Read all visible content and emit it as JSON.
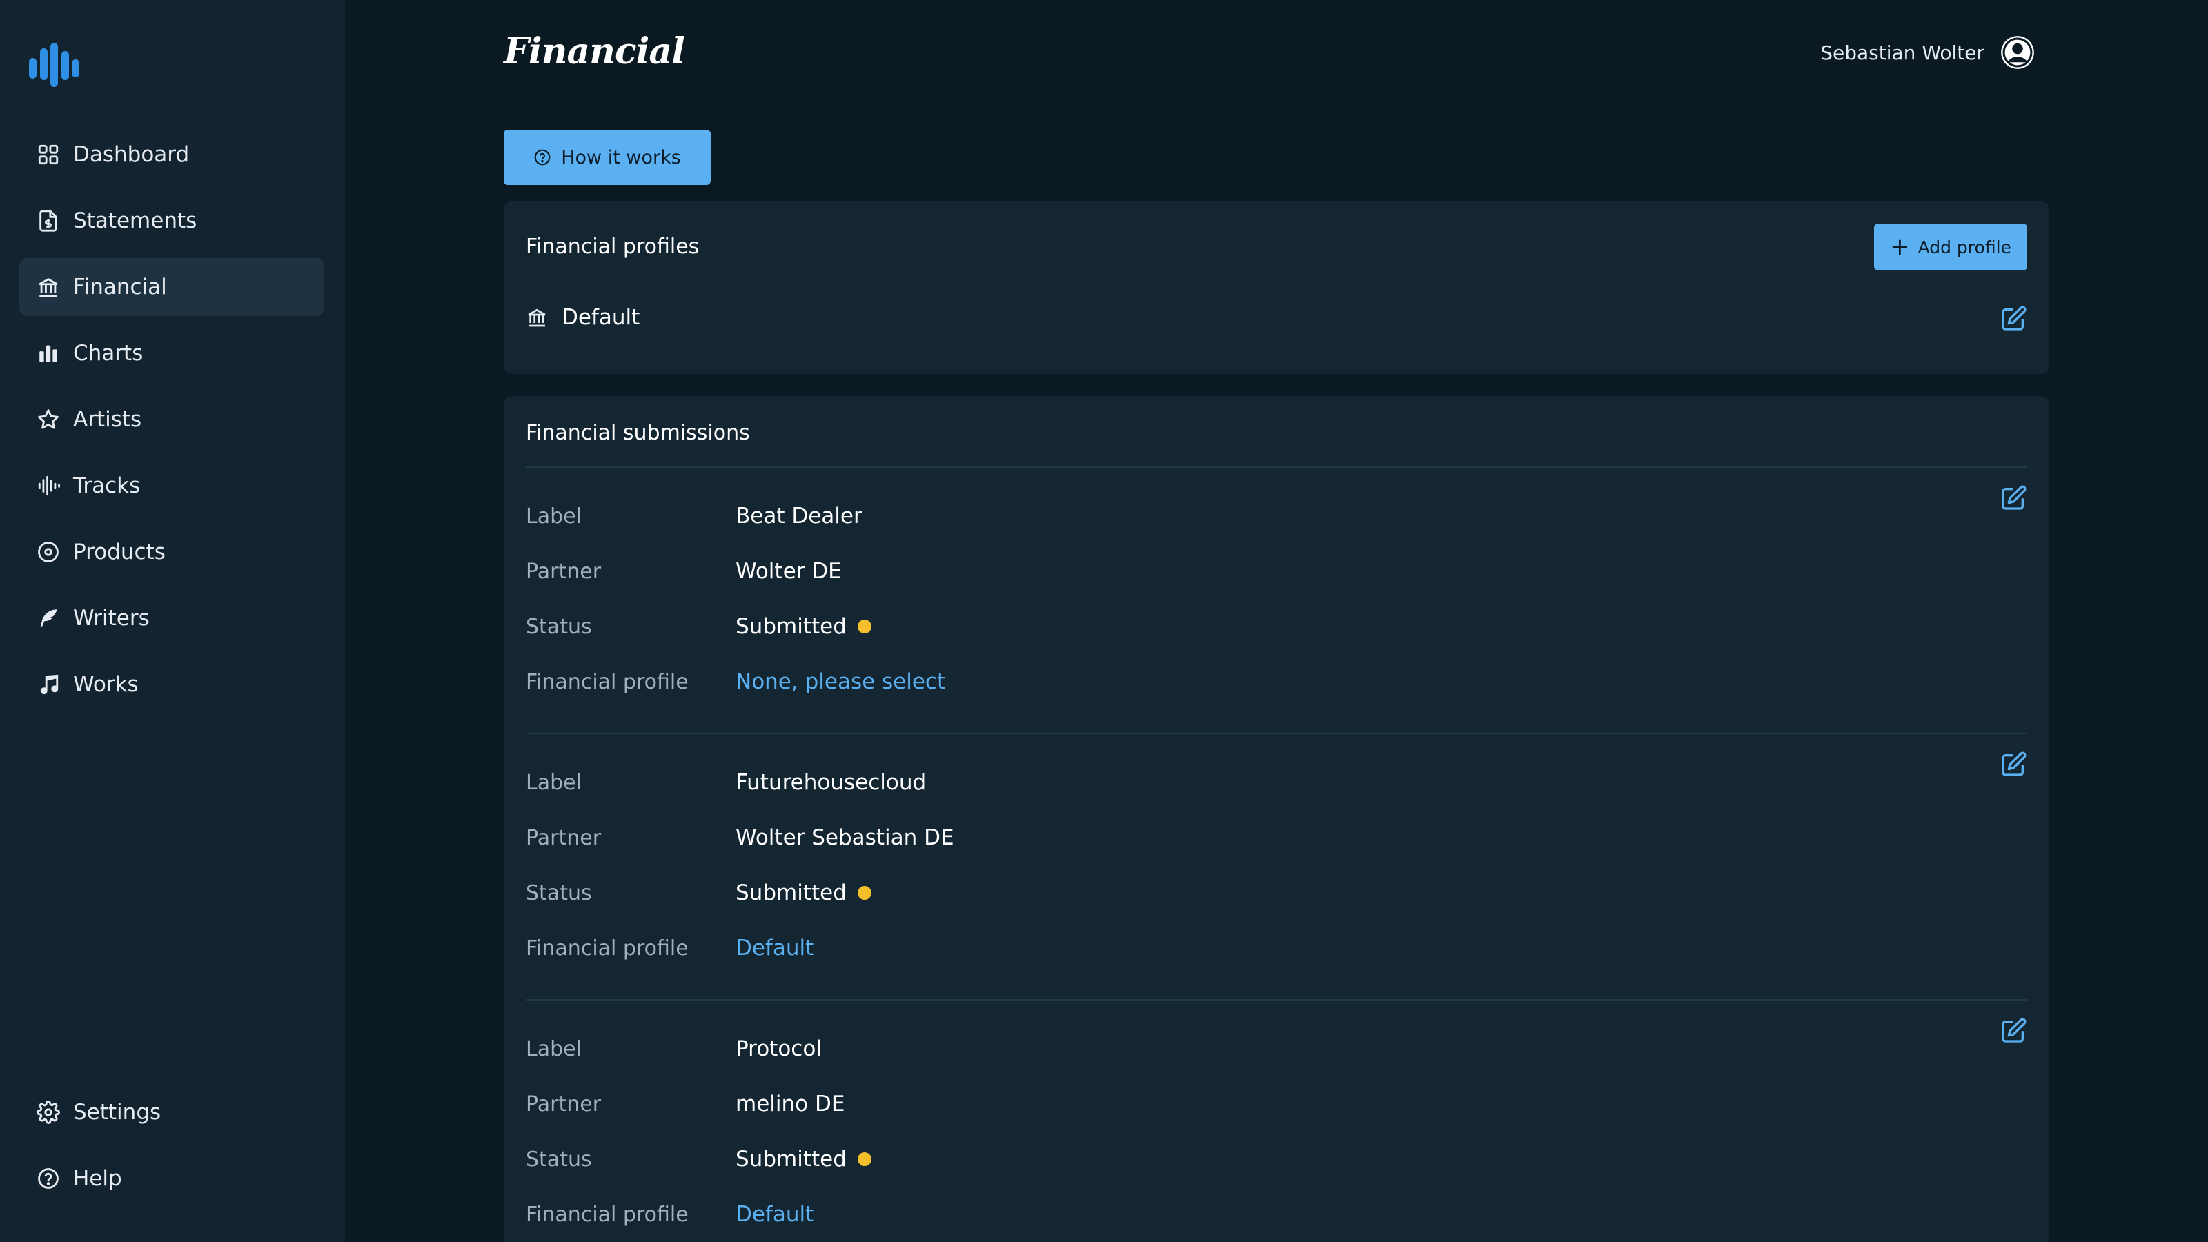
{
  "app": {
    "page_title": "Financial"
  },
  "colors": {
    "accent": "#5ab0f0",
    "status_submitted": "#f4bf2a",
    "sidebar_bg": "#132430",
    "page_bg": "#0b1923"
  },
  "sidebar": {
    "items": [
      {
        "label": "Dashboard",
        "icon": "grid-icon"
      },
      {
        "label": "Statements",
        "icon": "document-dollar-icon"
      },
      {
        "label": "Financial",
        "icon": "bank-icon",
        "active": true
      },
      {
        "label": "Charts",
        "icon": "bar-chart-icon"
      },
      {
        "label": "Artists",
        "icon": "star-icon"
      },
      {
        "label": "Tracks",
        "icon": "waveform-icon"
      },
      {
        "label": "Products",
        "icon": "disc-icon"
      },
      {
        "label": "Writers",
        "icon": "feather-icon"
      },
      {
        "label": "Works",
        "icon": "music-note-icon"
      }
    ],
    "bottom_items": [
      {
        "label": "Settings",
        "icon": "gear-icon"
      },
      {
        "label": "Help",
        "icon": "help-circle-icon"
      }
    ]
  },
  "header": {
    "user_name": "Sebastian Wolter",
    "how_it_works_label": "How it works"
  },
  "profiles": {
    "title": "Financial profiles",
    "add_label": "Add profile",
    "items": [
      {
        "name": "Default"
      }
    ]
  },
  "submissions": {
    "title": "Financial submissions",
    "field_labels": {
      "label": "Label",
      "partner": "Partner",
      "status": "Status",
      "profile": "Financial profile"
    },
    "items": [
      {
        "label": "Beat Dealer",
        "partner": "Wolter DE",
        "status": "Submitted",
        "profile": "None, please select"
      },
      {
        "label": "Futurehousecloud",
        "partner": "Wolter Sebastian DE",
        "status": "Submitted",
        "profile": "Default"
      },
      {
        "label": "Protocol",
        "partner": "melino DE",
        "status": "Submitted",
        "profile": "Default"
      }
    ]
  }
}
